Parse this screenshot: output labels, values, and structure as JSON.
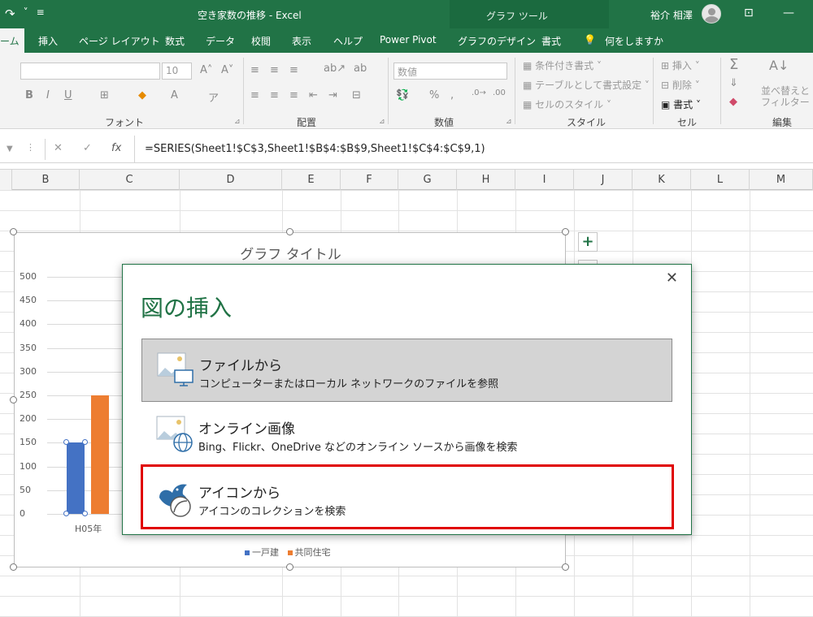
{
  "titlebar": {
    "doc_title": "空き家数の推移  -  Excel",
    "tool_title": "グラフ ツール",
    "user": "裕介 相澤"
  },
  "tabs": [
    {
      "label": "ーム",
      "active": true
    },
    {
      "label": "挿入"
    },
    {
      "label": "ページ レイアウト"
    },
    {
      "label": "数式"
    },
    {
      "label": "データ"
    },
    {
      "label": "校閲"
    },
    {
      "label": "表示"
    },
    {
      "label": "ヘルプ"
    },
    {
      "label": "Power Pivot"
    },
    {
      "label": "グラフのデザイン"
    },
    {
      "label": "書式"
    },
    {
      "label": "何をしますか"
    }
  ],
  "ribbon": {
    "groups": [
      "フォント",
      "配置",
      "数値",
      "スタイル",
      "セル",
      "編集"
    ],
    "font_size": "10",
    "number_format": "数値",
    "styles": [
      "条件付き書式",
      "テーブルとして書式設定",
      "セルのスタイル"
    ],
    "cells": [
      "挿入",
      "削除",
      "書式"
    ],
    "editing": "並べ替えと\nフィルター"
  },
  "formula": "=SERIES(Sheet1!$C$3,Sheet1!$B$4:$B$9,Sheet1!$C$4:$C$9,1)",
  "columns": [
    "B",
    "C",
    "D",
    "E",
    "F",
    "G",
    "H",
    "I",
    "J",
    "K",
    "L",
    "M"
  ],
  "chart_data": {
    "type": "bar",
    "title": "グラフ タイトル",
    "categories": [
      "H05年"
    ],
    "series": [
      {
        "name": "一戸建",
        "values": [
          150
        ],
        "color": "#4472c4"
      },
      {
        "name": "共同住宅",
        "values": [
          250
        ],
        "color": "#ed7d31"
      }
    ],
    "ylim": [
      0,
      500
    ],
    "yticks": [
      500,
      450,
      400,
      350,
      300,
      250,
      200,
      150,
      100,
      50,
      0
    ],
    "legend": "bottom"
  },
  "dialog": {
    "title": "図の挿入",
    "options": [
      {
        "title": "ファイルから",
        "desc": "コンピューターまたはローカル ネットワークのファイルを参照"
      },
      {
        "title": "オンライン画像",
        "desc": "Bing、Flickr、OneDrive などのオンライン ソースから画像を検索"
      },
      {
        "title": "アイコンから",
        "desc": "アイコンのコレクションを検索"
      }
    ]
  }
}
